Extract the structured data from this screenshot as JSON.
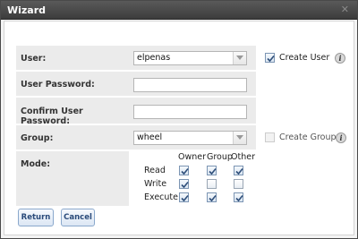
{
  "window": {
    "title": "Wizard",
    "close_icon": "close-icon"
  },
  "form": {
    "user": {
      "label": "User:",
      "value": "elpenas",
      "create_label": "Create User",
      "create_checked": true
    },
    "password": {
      "label": "User Password:",
      "value": ""
    },
    "confirm": {
      "label": "Confirm User Password:",
      "value": ""
    },
    "group": {
      "label": "Group:",
      "value": "wheel",
      "create_label": "Create Group",
      "create_checked": false
    },
    "mode": {
      "label": "Mode:",
      "columns": [
        "Owner",
        "Group",
        "Other"
      ],
      "rows": [
        {
          "name": "Read",
          "values": [
            true,
            true,
            true
          ]
        },
        {
          "name": "Write",
          "values": [
            true,
            false,
            false
          ]
        },
        {
          "name": "Execute",
          "values": [
            true,
            true,
            true
          ]
        }
      ]
    }
  },
  "buttons": {
    "return_label": "Return",
    "cancel_label": "Cancel"
  },
  "colors": {
    "titlebar": "#3c3c3c",
    "label_bg": "#ebebeb",
    "button_text": "#2a4a7a"
  }
}
